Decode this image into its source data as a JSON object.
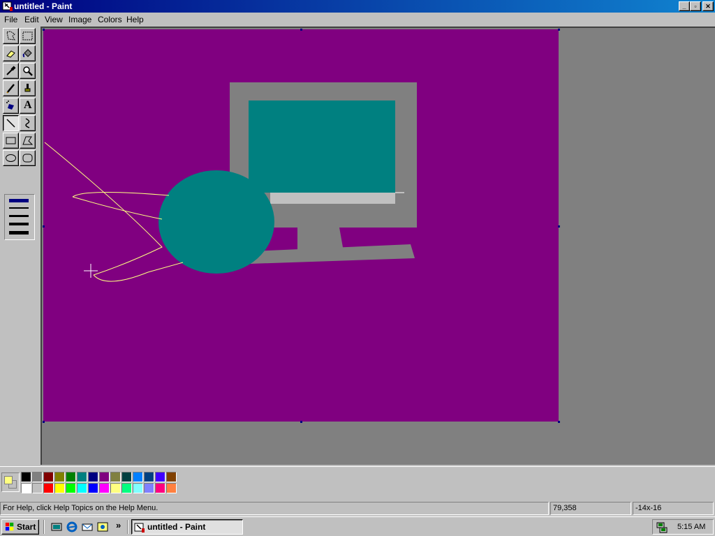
{
  "window": {
    "title": "untitled - Paint",
    "buttons": {
      "minimize": "_",
      "maximize": "▫",
      "close": "✕"
    }
  },
  "menu": [
    "File",
    "Edit",
    "View",
    "Image",
    "Colors",
    "Help"
  ],
  "toolbox": {
    "tools": [
      {
        "name": "free-form-select",
        "icon": "free-select-icon"
      },
      {
        "name": "select",
        "icon": "rect-select-icon"
      },
      {
        "name": "eraser",
        "icon": "eraser-icon"
      },
      {
        "name": "fill-with-color",
        "icon": "fill-bucket-icon"
      },
      {
        "name": "pick-color",
        "icon": "eyedropper-icon"
      },
      {
        "name": "magnifier",
        "icon": "magnifier-icon"
      },
      {
        "name": "pencil",
        "icon": "pencil-icon"
      },
      {
        "name": "brush",
        "icon": "brush-icon"
      },
      {
        "name": "airbrush",
        "icon": "airbrush-icon"
      },
      {
        "name": "text",
        "icon": "text-icon",
        "glyph": "A"
      },
      {
        "name": "line",
        "icon": "line-icon",
        "selected": true
      },
      {
        "name": "curve",
        "icon": "curve-icon"
      },
      {
        "name": "rectangle",
        "icon": "rectangle-icon"
      },
      {
        "name": "polygon",
        "icon": "polygon-icon"
      },
      {
        "name": "ellipse",
        "icon": "ellipse-icon"
      },
      {
        "name": "rounded-rectangle",
        "icon": "rounded-rect-icon"
      }
    ],
    "line_width_selected_index": 0
  },
  "canvas": {
    "background": "#800080",
    "shapes_colors": {
      "monitor": "#808080",
      "screen": "#008080",
      "bezel_highlight": "#c0c0c0",
      "ellipse": "#008080",
      "curves": "#ffff80"
    }
  },
  "palette": {
    "foreground": "#ffff80",
    "background": "#c0c0c0",
    "top_row": [
      "#000000",
      "#808080",
      "#800000",
      "#808000",
      "#008000",
      "#008080",
      "#000080",
      "#800080",
      "#808040",
      "#004040",
      "#0080ff",
      "#004080",
      "#4000ff",
      "#804000"
    ],
    "bottom_row": [
      "#ffffff",
      "#c0c0c0",
      "#ff0000",
      "#ffff00",
      "#00ff00",
      "#00ffff",
      "#0000ff",
      "#ff00ff",
      "#ffff80",
      "#00ff80",
      "#80ffff",
      "#8080ff",
      "#ff0080",
      "#ff8040"
    ]
  },
  "status": {
    "help": "For Help, click Help Topics on the Help Menu.",
    "coords": "79,358",
    "size": "-14x-16"
  },
  "taskbar": {
    "start_label": "Start",
    "chevron": "»",
    "task_label": "untitled - Paint",
    "clock": "5:15 AM"
  }
}
